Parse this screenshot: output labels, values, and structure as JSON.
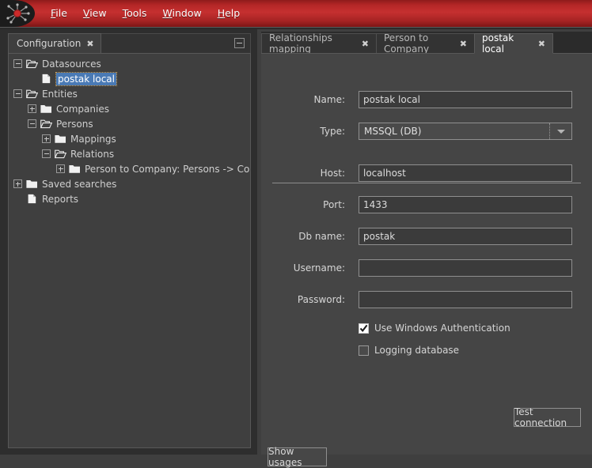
{
  "app": {
    "logo_icon": "network-graph-icon",
    "accent_color": "#c53030",
    "window_bg": "#454545"
  },
  "menubar": {
    "items": [
      {
        "label": "File",
        "mnemonic": "F"
      },
      {
        "label": "View",
        "mnemonic": "V"
      },
      {
        "label": "Tools",
        "mnemonic": "T"
      },
      {
        "label": "Window",
        "mnemonic": "W"
      },
      {
        "label": "Help",
        "mnemonic": "H"
      }
    ]
  },
  "left_dock": {
    "tab": {
      "label": "Configuration",
      "close": "✖"
    },
    "minimize_label": "–",
    "tree": [
      {
        "label": "Datasources",
        "depth": 0,
        "toggle": "minus",
        "icon": "folder-open-icon",
        "selected": false
      },
      {
        "label": "postak local",
        "depth": 1,
        "toggle": "none",
        "icon": "document-icon",
        "selected": true
      },
      {
        "label": "Entities",
        "depth": 0,
        "toggle": "minus",
        "icon": "folder-open-icon",
        "selected": false
      },
      {
        "label": "Companies",
        "depth": 1,
        "toggle": "plus",
        "icon": "folder-closed-icon",
        "selected": false
      },
      {
        "label": "Persons",
        "depth": 1,
        "toggle": "minus",
        "icon": "folder-open-icon",
        "selected": false
      },
      {
        "label": "Mappings",
        "depth": 2,
        "toggle": "plus",
        "icon": "folder-closed-icon",
        "selected": false
      },
      {
        "label": "Relations",
        "depth": 2,
        "toggle": "minus",
        "icon": "folder-open-icon",
        "selected": false
      },
      {
        "label": "Person to Company: Persons -> Companies  (",
        "depth": 3,
        "toggle": "plus",
        "icon": "folder-closed-icon",
        "selected": false
      },
      {
        "label": "Saved searches",
        "depth": 0,
        "toggle": "plus",
        "icon": "folder-closed-icon",
        "selected": false
      },
      {
        "label": "Reports",
        "depth": 0,
        "toggle": "none",
        "icon": "document-icon",
        "selected": false
      }
    ]
  },
  "right_dock": {
    "tabs": [
      {
        "label": "Relationships mapping",
        "close": "✖",
        "active": false
      },
      {
        "label": "Person to Company",
        "close": "✖",
        "active": false
      },
      {
        "label": "postak local",
        "close": "✖",
        "active": true
      }
    ],
    "form": {
      "name": {
        "label": "Name:",
        "value": "postak local",
        "placeholder": ""
      },
      "type": {
        "label": "Type:",
        "value": "MSSQL (DB)",
        "options": [
          "MSSQL (DB)"
        ]
      },
      "host": {
        "label": "Host:",
        "value": "localhost",
        "placeholder": ""
      },
      "port": {
        "label": "Port:",
        "value": "1433",
        "placeholder": ""
      },
      "db_name": {
        "label": "Db name:",
        "value": "postak",
        "placeholder": ""
      },
      "username": {
        "label": "Username:",
        "value": "",
        "placeholder": ""
      },
      "password": {
        "label": "Password:",
        "value": "",
        "placeholder": ""
      }
    },
    "checkboxes": [
      {
        "label": "Use Windows Authentication",
        "checked": true
      },
      {
        "label": "Logging database",
        "checked": false
      }
    ],
    "buttons": {
      "test_connection": "Test connection",
      "show_usages": "Show usages"
    }
  }
}
